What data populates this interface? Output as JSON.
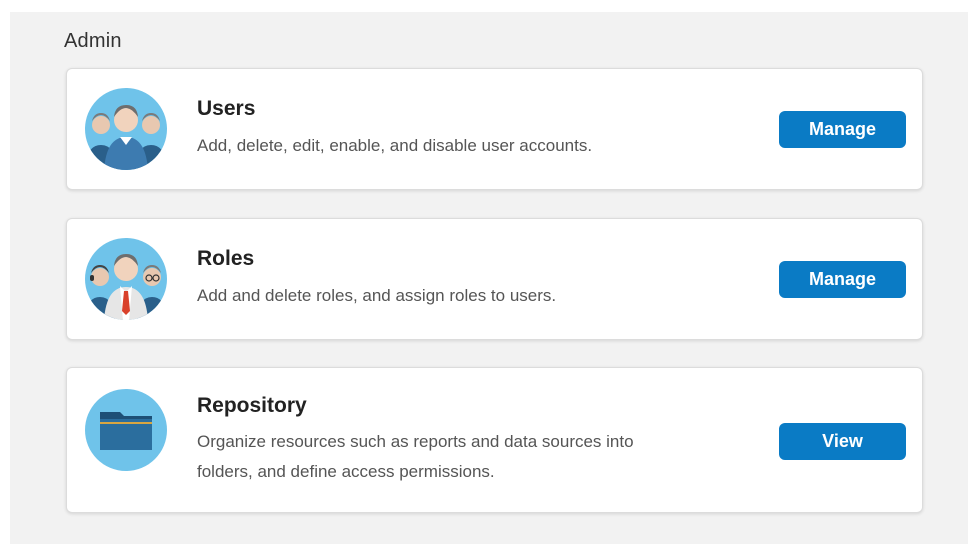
{
  "admin": {
    "heading": "Admin"
  },
  "cards": [
    {
      "title": "Users",
      "description": "Add, delete, edit, enable, and disable user accounts.",
      "button": "Manage",
      "icon": "users-icon"
    },
    {
      "title": "Roles",
      "description": "Add and delete roles, and assign roles to users.",
      "button": "Manage",
      "icon": "roles-icon"
    },
    {
      "title": "Repository",
      "description_line1": "Organize resources such as reports and data sources into",
      "description_line2": "folders, and define access permissions.",
      "button": "View",
      "icon": "folder-icon"
    }
  ],
  "colors": {
    "accent": "#0a7bc5",
    "icon_bg": "#6fc3ea",
    "panel_bg": "#f2f2f2"
  }
}
